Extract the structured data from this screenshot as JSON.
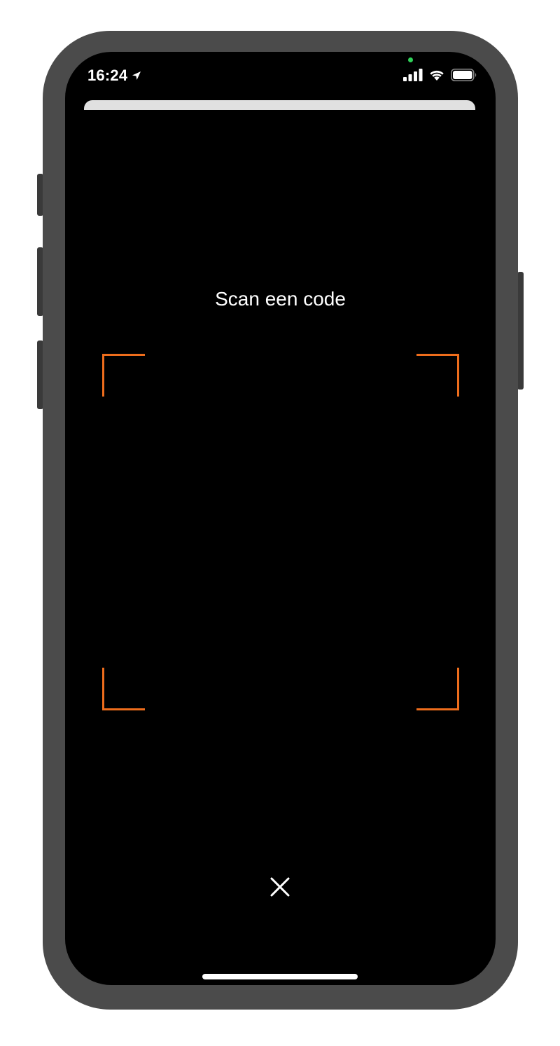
{
  "status_bar": {
    "time": "16:24",
    "location_icon": "location-arrow-icon",
    "signal_icon": "cellular-signal-icon",
    "wifi_icon": "wifi-icon",
    "battery_icon": "battery-icon"
  },
  "scanner": {
    "title": "Scan een code",
    "frame_color": "#ee6d1c",
    "close_icon": "close-icon"
  },
  "colors": {
    "device_frame": "#4b4b4b",
    "screen_background": "#000000",
    "text": "#ffffff",
    "camera_indicator": "#2fd158"
  }
}
